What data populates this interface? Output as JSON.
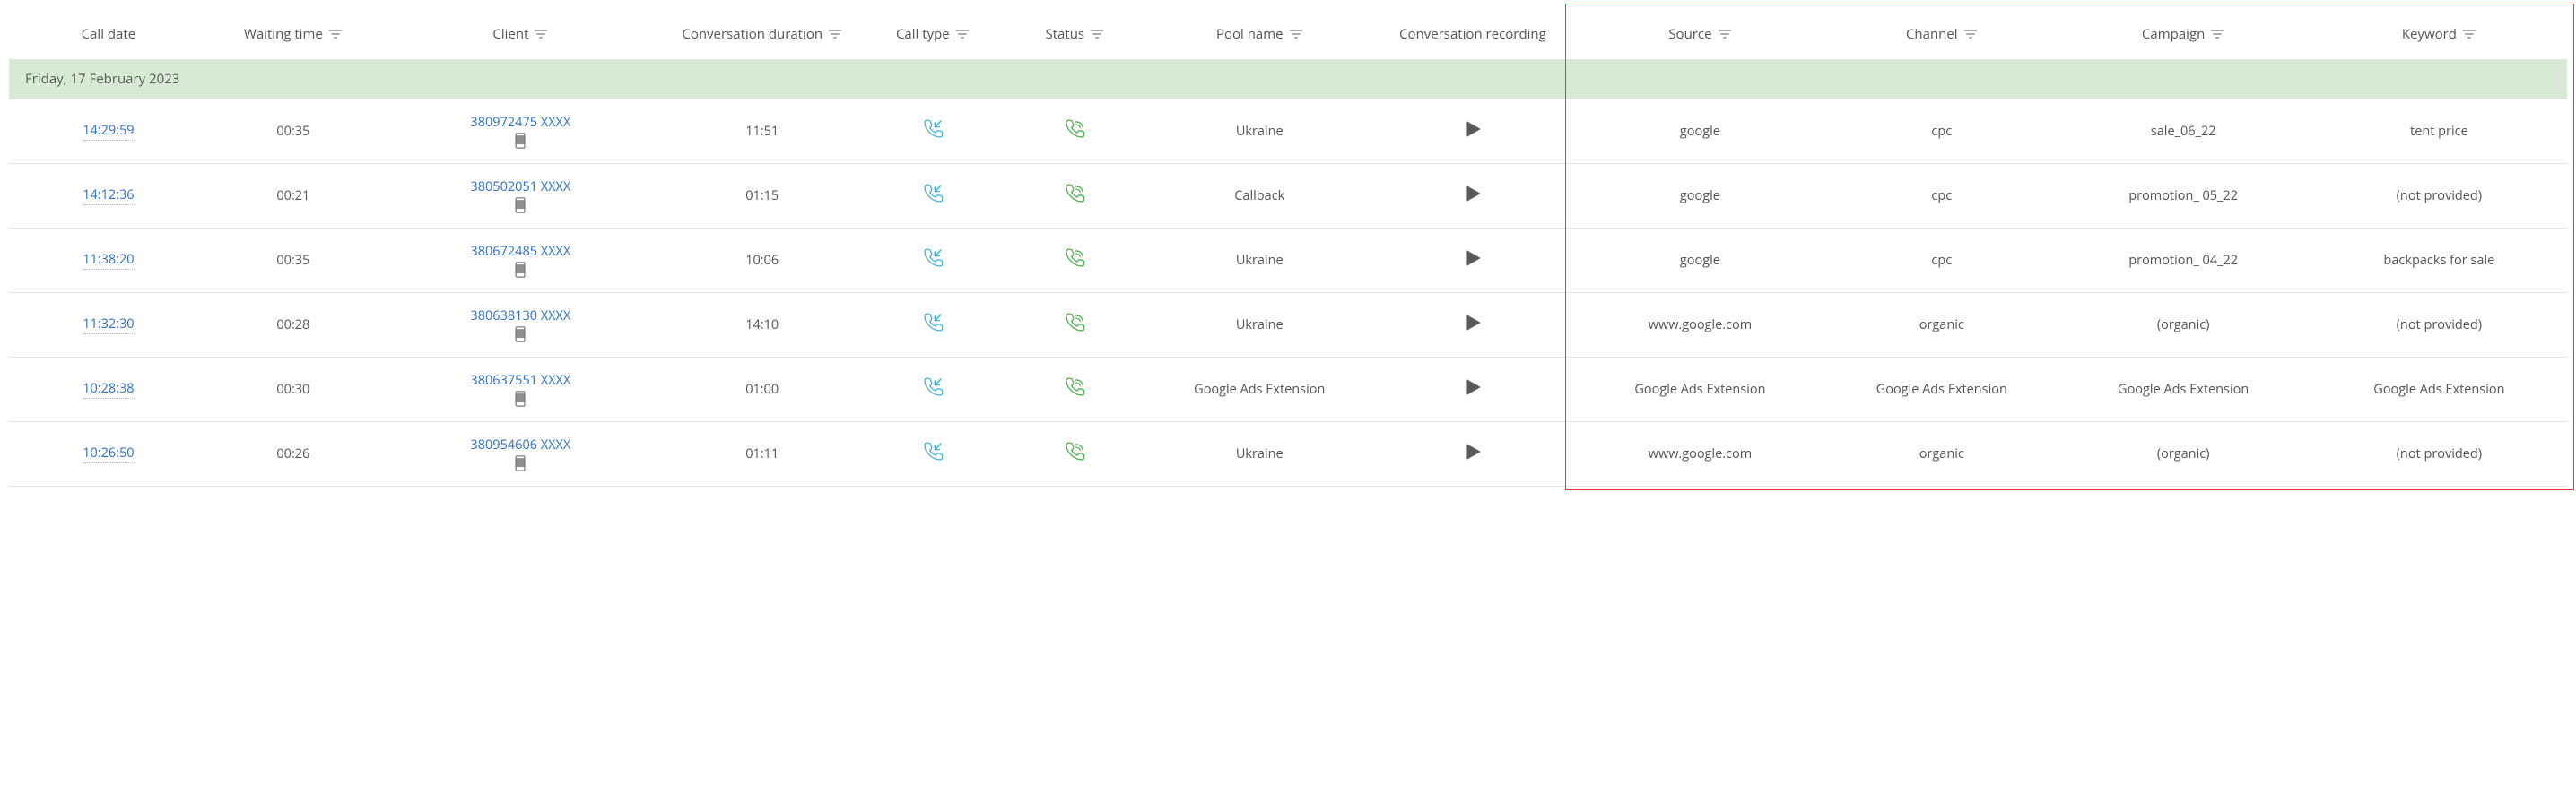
{
  "columns": [
    {
      "key": "call_date",
      "label": "Call date",
      "filter": false
    },
    {
      "key": "waiting",
      "label": "Waiting time",
      "filter": true
    },
    {
      "key": "client",
      "label": "Client",
      "filter": true
    },
    {
      "key": "duration",
      "label": "Conversation duration",
      "filter": true
    },
    {
      "key": "call_type",
      "label": "Call type",
      "filter": true
    },
    {
      "key": "status",
      "label": "Status",
      "filter": true
    },
    {
      "key": "pool",
      "label": "Pool name",
      "filter": true
    },
    {
      "key": "recording",
      "label": "Conversation recording",
      "filter": false
    },
    {
      "key": "source",
      "label": "Source",
      "filter": true
    },
    {
      "key": "channel",
      "label": "Channel",
      "filter": true
    },
    {
      "key": "campaign",
      "label": "Campaign",
      "filter": true
    },
    {
      "key": "keyword",
      "label": "Keyword",
      "filter": true
    }
  ],
  "group_label": "Friday, 17 February 2023",
  "rows": [
    {
      "call_date": "14:29:59",
      "waiting": "00:35",
      "client": "380972475 XXXX",
      "duration": "11:51",
      "call_type": "incoming",
      "status": "answered",
      "pool": "Ukraine",
      "recording": true,
      "source": "google",
      "channel": "cpc",
      "campaign": "sale_06_22",
      "keyword": "tent price"
    },
    {
      "call_date": "14:12:36",
      "waiting": "00:21",
      "client": "380502051 XXXX",
      "duration": "01:15",
      "call_type": "incoming",
      "status": "answered",
      "pool": "Callback",
      "recording": true,
      "source": "google",
      "channel": "cpc",
      "campaign": "promotion_ 05_22",
      "keyword": "(not provided)"
    },
    {
      "call_date": "11:38:20",
      "waiting": "00:35",
      "client": "380672485 XXXX",
      "duration": "10:06",
      "call_type": "incoming",
      "status": "answered",
      "pool": "Ukraine",
      "recording": true,
      "source": "google",
      "channel": "cpc",
      "campaign": "promotion_ 04_22",
      "keyword": "backpacks for sale"
    },
    {
      "call_date": "11:32:30",
      "waiting": "00:28",
      "client": "380638130 XXXX",
      "duration": "14:10",
      "call_type": "incoming",
      "status": "answered",
      "pool": "Ukraine",
      "recording": true,
      "source": "www.google.com",
      "channel": "organic",
      "campaign": "(organic)",
      "keyword": "(not provided)"
    },
    {
      "call_date": "10:28:38",
      "waiting": "00:30",
      "client": "380637551 XXXX",
      "duration": "01:00",
      "call_type": "incoming",
      "status": "answered",
      "pool": "Google Ads Extension",
      "recording": true,
      "source": "Google Ads Extension",
      "channel": "Google Ads Extension",
      "campaign": "Google Ads Extension",
      "keyword": "Google Ads Extension"
    },
    {
      "call_date": "10:26:50",
      "waiting": "00:26",
      "client": "380954606 XXXX",
      "duration": "01:11",
      "call_type": "incoming",
      "status": "answered",
      "pool": "Ukraine",
      "recording": true,
      "source": "www.google.com",
      "channel": "organic",
      "campaign": "(organic)",
      "keyword": "(not provided)"
    }
  ],
  "highlight": {
    "from_col": "source",
    "to_col": "keyword"
  }
}
